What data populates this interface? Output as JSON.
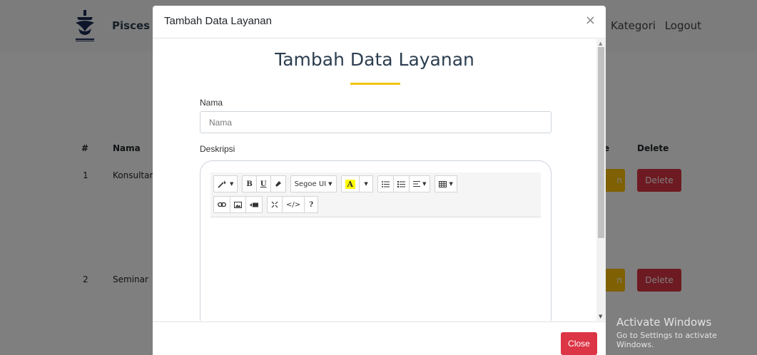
{
  "background": {
    "brand": "Pisces P",
    "nav_links": [
      "Kategori",
      "Logout"
    ],
    "table": {
      "headers": {
        "number": "#",
        "name": "Nama",
        "edit_fragment": "e",
        "delete": "Delete"
      },
      "rows": [
        {
          "number": "1",
          "name": "Konsultan",
          "edit_fragment": "n",
          "delete": "Delete"
        },
        {
          "number": "2",
          "name": "Seminar",
          "edit_fragment": "n",
          "delete": "Delete"
        }
      ]
    }
  },
  "watermark": {
    "line1": "Activate Windows",
    "line2": "Go to Settings to activate Windows."
  },
  "modal": {
    "title": "Tambah Data Layanan",
    "close_symbol": "×",
    "heading": "Tambah Data Layanan",
    "fields": {
      "nama_label": "Nama",
      "nama_placeholder": "Nama",
      "nama_value": "",
      "deskripsi_label": "Deskripsi"
    },
    "toolbar": {
      "font_name": "Segoe UI",
      "bold": "B",
      "underline": "U",
      "highlight": "A",
      "help": "?",
      "code": "</>"
    },
    "footer": {
      "close_label": "Close"
    }
  },
  "colors": {
    "accent_underline": "#f1c40f",
    "close_button": "#dc3545",
    "edit_button": "#ffc107",
    "delete_button": "#dc3545"
  }
}
